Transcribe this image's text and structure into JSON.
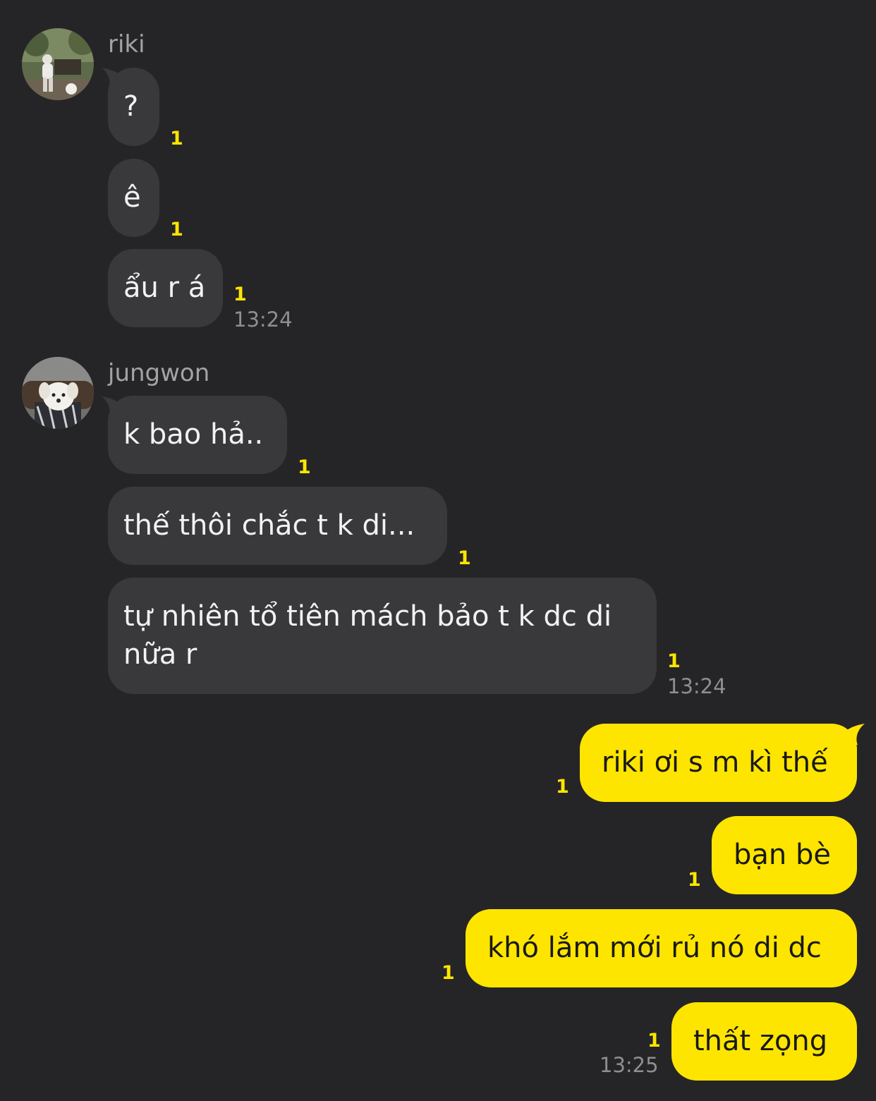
{
  "groups": [
    {
      "sender": "riki",
      "messages": [
        {
          "text": "?",
          "unread": "1"
        },
        {
          "text": "ê",
          "unread": "1"
        },
        {
          "text": "ẩu r á",
          "unread": "1",
          "time": "13:24"
        }
      ]
    },
    {
      "sender": "jungwon",
      "messages": [
        {
          "text": "k bao hả..",
          "unread": "1"
        },
        {
          "text": "thế thôi chắc t k di...",
          "unread": "1"
        },
        {
          "text": "tự nhiên tổ tiên mách bảo t k dc di nữa r",
          "unread": "1",
          "time": "13:24"
        }
      ]
    },
    {
      "sender": "",
      "outgoing": true,
      "messages": [
        {
          "text": "riki ơi s m kì thế",
          "unread": "1"
        },
        {
          "text": "bạn bè",
          "unread": "1"
        },
        {
          "text": "khó lắm mới rủ nó di dc",
          "unread": "1"
        },
        {
          "text": "thất zọng",
          "unread": "1",
          "time": "13:25"
        }
      ]
    }
  ],
  "colors": {
    "background": "#252527",
    "incoming_bubble": "#39393c",
    "outgoing_bubble": "#fee500",
    "unread_count": "#fee500"
  }
}
